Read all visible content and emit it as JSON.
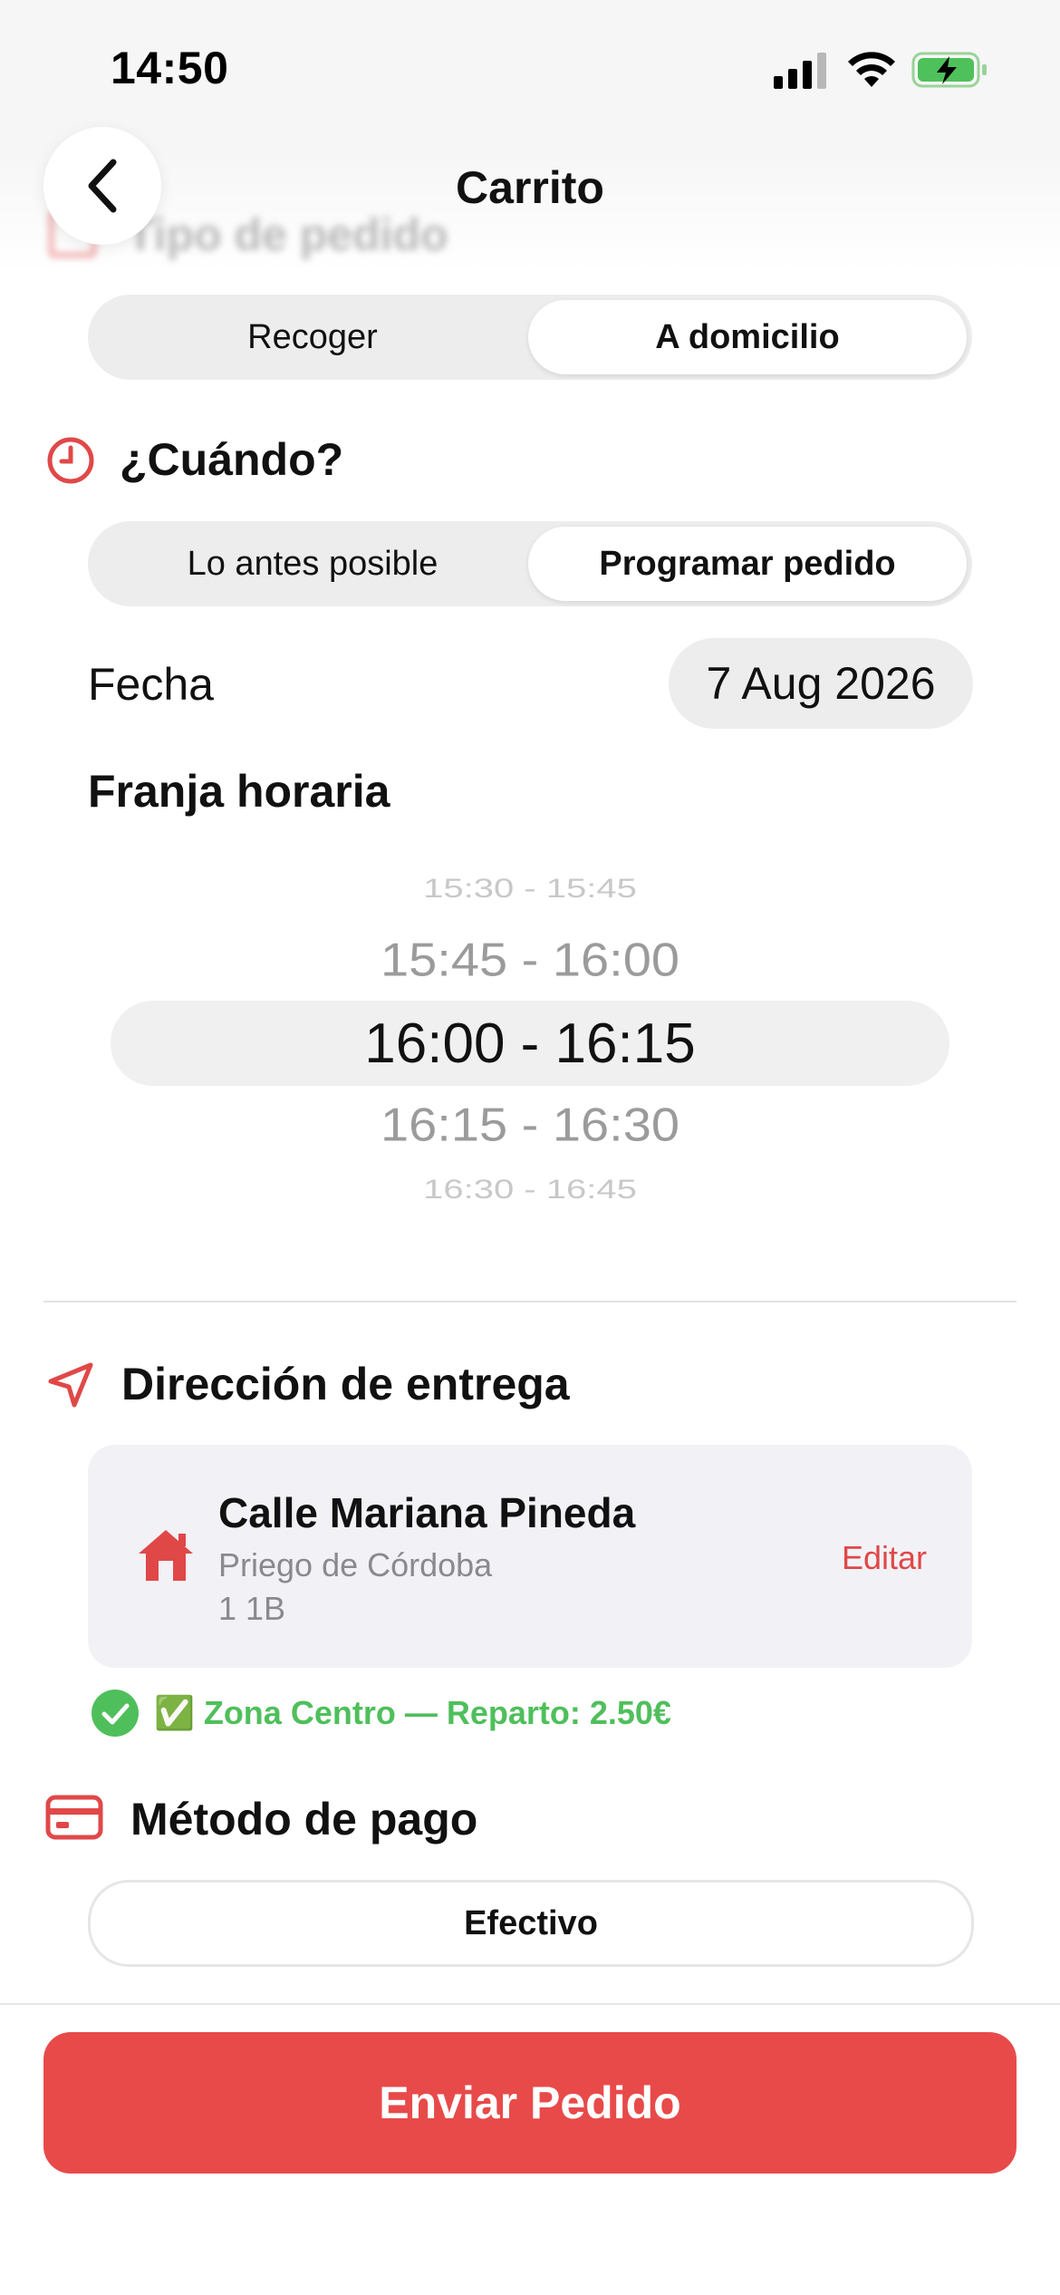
{
  "status_bar": {
    "time": "14:50"
  },
  "nav": {
    "title": "Carrito"
  },
  "order_type": {
    "title": "Tipo de pedido",
    "options": [
      "Recoger",
      "A domicilio"
    ],
    "selected": "A domicilio"
  },
  "when": {
    "title": "¿Cuándo?",
    "options": [
      "Lo antes posible",
      "Programar pedido"
    ],
    "selected": "Programar pedido",
    "date_label": "Fecha",
    "date_value": "7 Aug 2026",
    "slot_label": "Franja horaria",
    "slots": [
      "15:30 - 15:45",
      "15:45 - 16:00",
      "16:00 - 16:15",
      "16:15 - 16:30",
      "16:30 - 16:45"
    ],
    "selected_slot": "16:00 - 16:15"
  },
  "delivery": {
    "title": "Dirección de entrega",
    "address_line1": "Calle Mariana Pineda",
    "address_line2": "Priego de Córdoba",
    "address_line3": "1 1B",
    "edit_label": "Editar",
    "zone_text": "✅ Zona Centro — Reparto: 2.50€"
  },
  "payment": {
    "title": "Método de pago",
    "method": "Efectivo"
  },
  "submit_label": "Enviar Pedido",
  "colors": {
    "accent": "#e84a4a",
    "success": "#4fbf5b",
    "segment_bg": "#ededed"
  }
}
